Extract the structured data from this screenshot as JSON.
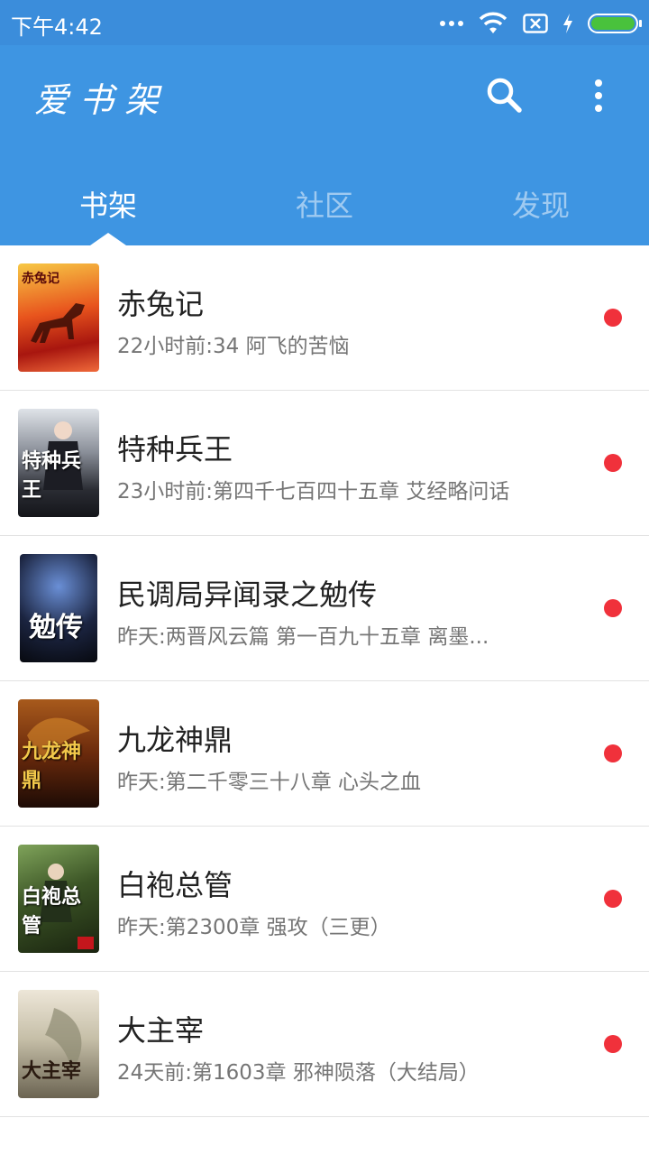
{
  "status_bar": {
    "time": "下午4:42"
  },
  "app_bar": {
    "title": "爱书架",
    "search_icon": "search-icon",
    "more_icon": "more-vert-icon"
  },
  "tabs": [
    {
      "label": "书架",
      "active": true
    },
    {
      "label": "社区",
      "active": false
    },
    {
      "label": "发现",
      "active": false
    }
  ],
  "books": [
    {
      "title": "赤兔记",
      "update": "22小时前:34 阿飞的苦恼",
      "cover_label": "赤兔记",
      "unread": true
    },
    {
      "title": "特种兵王",
      "update": "23小时前:第四千七百四十五章 艾经略问话",
      "cover_label": "特种兵王",
      "unread": true
    },
    {
      "title": "民调局异闻录之勉传",
      "update": "昨天:两晋风云篇 第一百九十五章  离墨...",
      "cover_label": "勉传",
      "unread": true
    },
    {
      "title": "九龙神鼎",
      "update": "昨天:第二千零三十八章 心头之血",
      "cover_label": "九龙神鼎",
      "unread": true
    },
    {
      "title": "白袍总管",
      "update": "昨天:第2300章 强攻（三更）",
      "cover_label": "白袍总管",
      "unread": true
    },
    {
      "title": "大主宰",
      "update": "24天前:第1603章 邪神陨落（大结局）",
      "cover_label": "大主宰",
      "unread": true
    }
  ],
  "colors": {
    "status_bar": "#3b8ddb",
    "app_bar": "#3e95e2",
    "unread_dot": "#f0313b",
    "battery": "#49c23c"
  }
}
